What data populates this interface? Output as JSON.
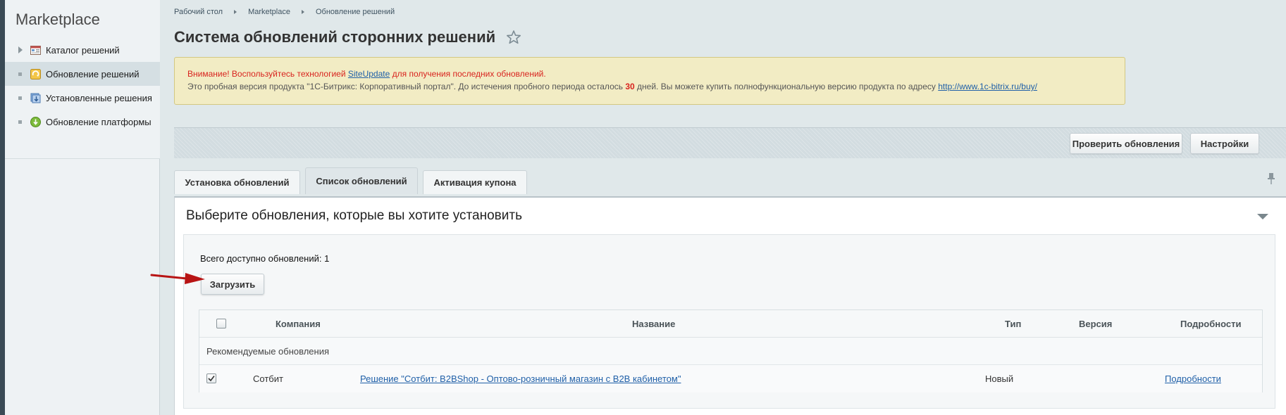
{
  "sidebar": {
    "title": "Marketplace",
    "items": [
      {
        "label": "Каталог решений",
        "icon": "catalog-icon",
        "active": false
      },
      {
        "label": "Обновление решений",
        "icon": "update-icon",
        "active": true
      },
      {
        "label": "Установленные решения",
        "icon": "installed-icon",
        "active": false
      },
      {
        "label": "Обновление платформы",
        "icon": "platform-update-icon",
        "active": false
      }
    ]
  },
  "breadcrumbs": [
    "Рабочий стол",
    "Marketplace",
    "Обновление решений"
  ],
  "page_title": "Система обновлений сторонних решений",
  "alert": {
    "line1_prefix": "Внимание! Воспользуйтесь технологией",
    "line1_link": "SiteUpdate",
    "line1_suffix": "для получения последних обновлений.",
    "line2_prefix": "Это пробная версия продукта \"1С-Битрикс: Корпоративный портал\". До истечения пробного периода осталось",
    "line2_days": "30",
    "line2_middle": "дней. Вы можете купить полнофункциональную версию продукта по адресу",
    "line2_link": "http://www.1c-bitrix.ru/buy/"
  },
  "toolbar": {
    "check_updates": "Проверить обновления",
    "settings": "Настройки"
  },
  "tabs": [
    {
      "label": "Установка обновлений",
      "active": false
    },
    {
      "label": "Список обновлений",
      "active": true
    },
    {
      "label": "Активация купона",
      "active": false
    }
  ],
  "panel": {
    "title": "Выберите обновления, которые вы хотите установить",
    "total_label": "Всего доступно обновлений: 1",
    "load_button": "Загрузить"
  },
  "table": {
    "columns": [
      "Компания",
      "Название",
      "Тип",
      "Версия",
      "Подробности"
    ],
    "group_label": "Рекомендуемые обновления",
    "rows": [
      {
        "checked": true,
        "company": "Сотбит",
        "name": "Решение \"Сотбит: B2BShop - Оптово-розничный магазин с B2B кабинетом\"",
        "type": "Новый",
        "version": "",
        "details": "Подробности"
      }
    ]
  },
  "colors": {
    "accent_red": "#d8231e",
    "link_blue": "#2060a8",
    "alert_bg": "#f2ecc4"
  }
}
